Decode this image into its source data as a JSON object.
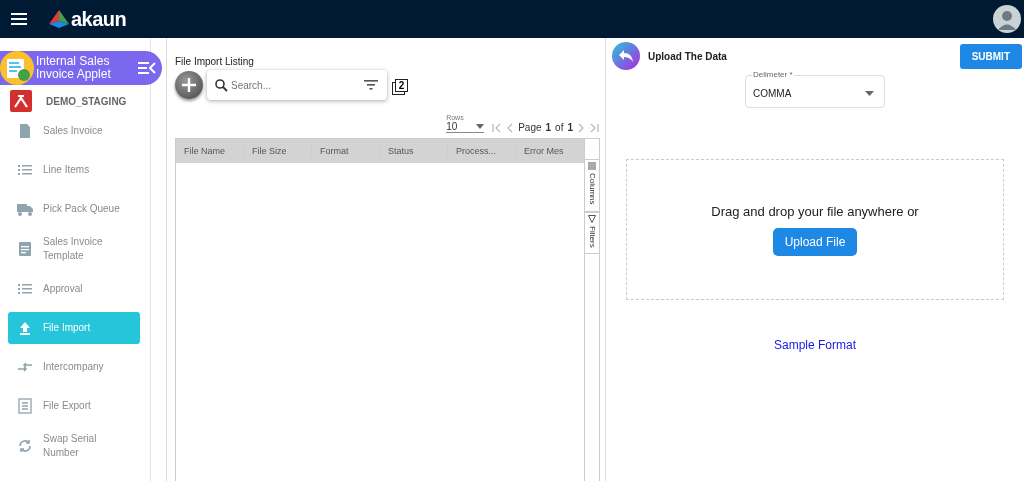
{
  "topbar": {
    "brand": "akaun"
  },
  "applet": {
    "title": "Internal Sales Invoice Applet",
    "company": "DEMO_STAGING"
  },
  "sidebar": {
    "items": [
      {
        "label": "Sales Invoice",
        "selected": false
      },
      {
        "label": "Line Items",
        "selected": false
      },
      {
        "label": "Pick Pack Queue",
        "selected": false
      },
      {
        "label": "Sales Invoice Template",
        "selected": false
      },
      {
        "label": "Approval",
        "selected": false
      },
      {
        "label": "File Import",
        "selected": true
      },
      {
        "label": "Intercompany",
        "selected": false
      },
      {
        "label": "File Export",
        "selected": false
      },
      {
        "label": "Swap Serial Number",
        "selected": false
      }
    ]
  },
  "listing": {
    "title": "File Import Listing",
    "search": {
      "placeholder": "Search..."
    },
    "badge": "2",
    "paging": {
      "rows_label": "Rows",
      "rows": "10",
      "page_label": "Page",
      "page": "1",
      "of_label": "of",
      "pages": "1"
    },
    "columns": [
      "File Name",
      "File Size",
      "Format",
      "Status",
      "Process...",
      "Error Mes"
    ],
    "side_tabs": [
      "Columns",
      "Filters"
    ]
  },
  "upload": {
    "title": "Upload The Data",
    "submit": "SUBMIT",
    "delimiter": {
      "label": "Delimeter *",
      "value": "COMMA"
    },
    "drop_text": "Drag and drop your file anywhere or",
    "upload_button": "Upload File",
    "sample_link": "Sample Format"
  }
}
